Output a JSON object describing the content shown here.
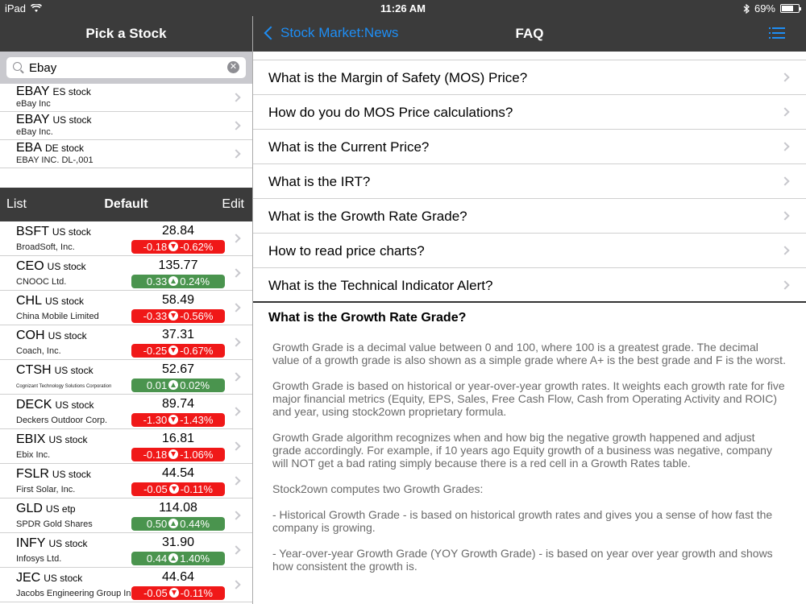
{
  "status_bar": {
    "device": "iPad",
    "time": "11:26 AM",
    "battery": "69%",
    "battery_level": 0.69
  },
  "left_pane": {
    "title": "Pick a Stock",
    "search": {
      "value": "Ebay",
      "placeholder": ""
    },
    "results": [
      {
        "ticker": "EBAY",
        "exchange": "ES stock",
        "name": "eBay Inc"
      },
      {
        "ticker": "EBAY",
        "exchange": "US stock",
        "name": "eBay Inc."
      },
      {
        "ticker": "EBA",
        "exchange": "DE stock",
        "name": "EBAY INC. DL-,001"
      }
    ],
    "toolbar": {
      "left": "List",
      "title": "Default",
      "right": "Edit"
    },
    "stocks": [
      {
        "ticker": "BSFT",
        "exchange": "US stock",
        "name": "BroadSoft, Inc.",
        "price": "28.84",
        "change": "-0.18",
        "pct": "-0.62%",
        "dir": "down"
      },
      {
        "ticker": "CEO",
        "exchange": "US stock",
        "name": "CNOOC Ltd.",
        "price": "135.77",
        "change": "0.33",
        "pct": "0.24%",
        "dir": "up"
      },
      {
        "ticker": "CHL",
        "exchange": "US stock",
        "name": "China Mobile Limited",
        "price": "58.49",
        "change": "-0.33",
        "pct": "-0.56%",
        "dir": "down"
      },
      {
        "ticker": "COH",
        "exchange": "US stock",
        "name": "Coach, Inc.",
        "price": "37.31",
        "change": "-0.25",
        "pct": "-0.67%",
        "dir": "down"
      },
      {
        "ticker": "CTSH",
        "exchange": "US stock",
        "name": "Cognizant Technology Solutions Corporation",
        "price": "52.67",
        "change": "0.01",
        "pct": "0.02%",
        "dir": "up"
      },
      {
        "ticker": "DECK",
        "exchange": "US stock",
        "name": "Deckers Outdoor Corp.",
        "price": "89.74",
        "change": "-1.30",
        "pct": "-1.43%",
        "dir": "down"
      },
      {
        "ticker": "EBIX",
        "exchange": "US stock",
        "name": "Ebix Inc.",
        "price": "16.81",
        "change": "-0.18",
        "pct": "-1.06%",
        "dir": "down"
      },
      {
        "ticker": "FSLR",
        "exchange": "US stock",
        "name": "First Solar, Inc.",
        "price": "44.54",
        "change": "-0.05",
        "pct": "-0.11%",
        "dir": "down"
      },
      {
        "ticker": "GLD",
        "exchange": "US etp",
        "name": "SPDR Gold Shares",
        "price": "114.08",
        "change": "0.50",
        "pct": "0.44%",
        "dir": "up"
      },
      {
        "ticker": "INFY",
        "exchange": "US stock",
        "name": "Infosys Ltd.",
        "price": "31.90",
        "change": "0.44",
        "pct": "1.40%",
        "dir": "up"
      },
      {
        "ticker": "JEC",
        "exchange": "US stock",
        "name": "Jacobs Engineering Group Inc.",
        "price": "44.64",
        "change": "-0.05",
        "pct": "-0.11%",
        "dir": "down"
      }
    ]
  },
  "right_pane": {
    "back_label": "Stock Market:News",
    "title": "FAQ",
    "faq": [
      "What is the Margin of Safety (MOS) Price?",
      "How do you do MOS Price calculations?",
      "What is the Current Price?",
      "What is the IRT?",
      "What is the Growth Rate Grade?",
      "How to read price charts?",
      "What is the Technical Indicator Alert?"
    ],
    "answer": {
      "heading": "What is the Growth Rate Grade?",
      "paragraphs": [
        "Growth Grade is a decimal value between 0 and 100, where 100 is a greatest grade. The decimal value of a growth grade is also shown as a simple grade where A+ is the best grade and F is the worst.",
        "Growth Grade is based on historical or year-over-year growth rates. It weights each growth rate for five major financial metrics (Equity, EPS, Sales, Free Cash Flow, Cash from Operating Activity and ROIC) and year, using stock2own proprietary formula.",
        "Growth Grade algorithm recognizes when and how big the negative growth happened and adjust grade accordingly. For example, if 10 years ago Equity growth of a business was negative, company will NOT get a bad rating simply because there is a red cell in a Growth Rates table.",
        "Stock2own computes two Growth Grades:",
        "- Historical Growth Grade - is based on historical growth rates and gives you a sense of how fast the company is growing.",
        "- Year-over-year Growth Grade (YOY Growth Grade) - is based on year over year growth and shows how consistent the growth is."
      ]
    }
  },
  "colors": {
    "bar": "#3b3b3b",
    "accent": "#1e8ef5",
    "up": "#4a944e",
    "down": "#f01818"
  }
}
